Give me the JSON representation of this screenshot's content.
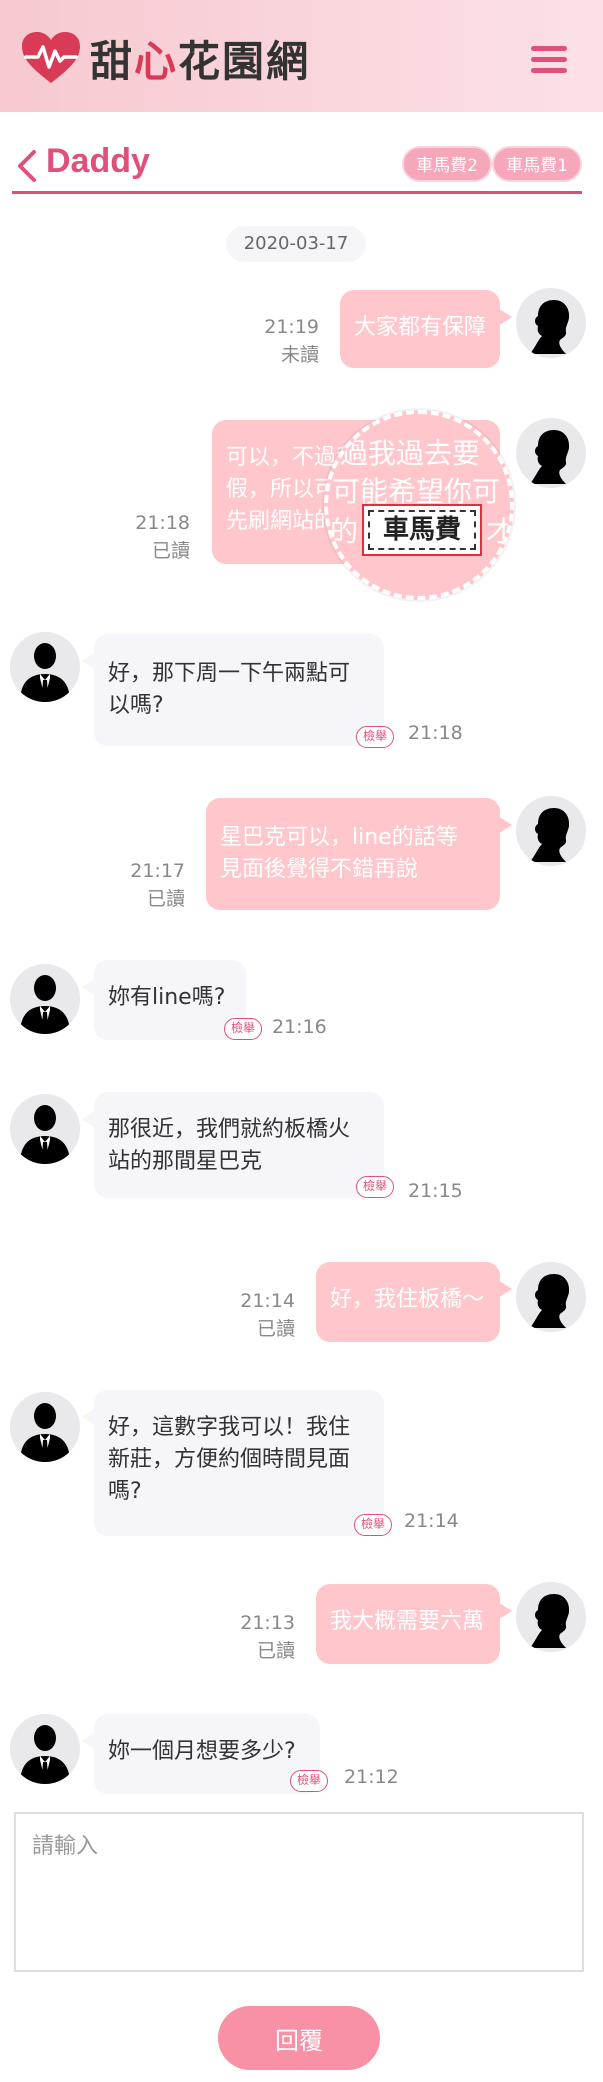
{
  "header": {
    "logo_text": "甜心花園網",
    "logo_text_accent": "心",
    "menu_icon": "hamburger-icon"
  },
  "conversation": {
    "title": "Daddy",
    "tags": [
      "車馬費2",
      "車馬費1"
    ],
    "date": "2020-03-17"
  },
  "messages": [
    {
      "from": "me",
      "text": "大家都有保障",
      "time": "21:19",
      "status": "未讀"
    },
    {
      "from": "me",
      "text_lines": [
        "可以，不過我過去要請",
        "假，所以可能希望你可以",
        "先刷網站的車馬費才去"
      ],
      "time": "21:18",
      "status": "已讀"
    },
    {
      "from": "them",
      "text_lines": [
        "好，那下周一下午兩點可",
        "以嗎?"
      ],
      "time": "21:18",
      "report": "檢舉"
    },
    {
      "from": "me",
      "text_lines": [
        "星巴克可以，line的話等",
        "見面後覺得不錯再說"
      ],
      "time": "21:17",
      "status": "已讀"
    },
    {
      "from": "them",
      "text": "妳有line嗎?",
      "time": "21:16",
      "report": "檢舉"
    },
    {
      "from": "them",
      "text_lines": [
        "那很近，我們就約板橋火",
        "站的那間星巴克"
      ],
      "time": "21:15",
      "report": "檢舉"
    },
    {
      "from": "me",
      "text": "好，我住板橋～",
      "time": "21:14",
      "status": "已讀"
    },
    {
      "from": "them",
      "text_lines": [
        "好，這數字我可以！我住",
        "新莊，方便約個時間見面",
        "嗎?"
      ],
      "time": "21:14",
      "report": "檢舉"
    },
    {
      "from": "me",
      "text": "我大概需要六萬",
      "time": "21:13",
      "status": "已讀"
    },
    {
      "from": "them",
      "text": "妳一個月想要多少?",
      "time": "21:12",
      "report": "檢舉"
    }
  ],
  "magnifier": {
    "label": "車馬費",
    "visible_fragments": [
      "過我過去要",
      "可能希望你可",
      "的",
      "車馬費",
      "才去"
    ]
  },
  "compose": {
    "placeholder": "請輸入",
    "value": "",
    "reply_label": "回覆"
  },
  "colors": {
    "brand": "#e0517a",
    "my_bubble": "#ffc7cc",
    "their_bubble": "#f5f5fa",
    "header_bg": "#f7c9d0"
  }
}
